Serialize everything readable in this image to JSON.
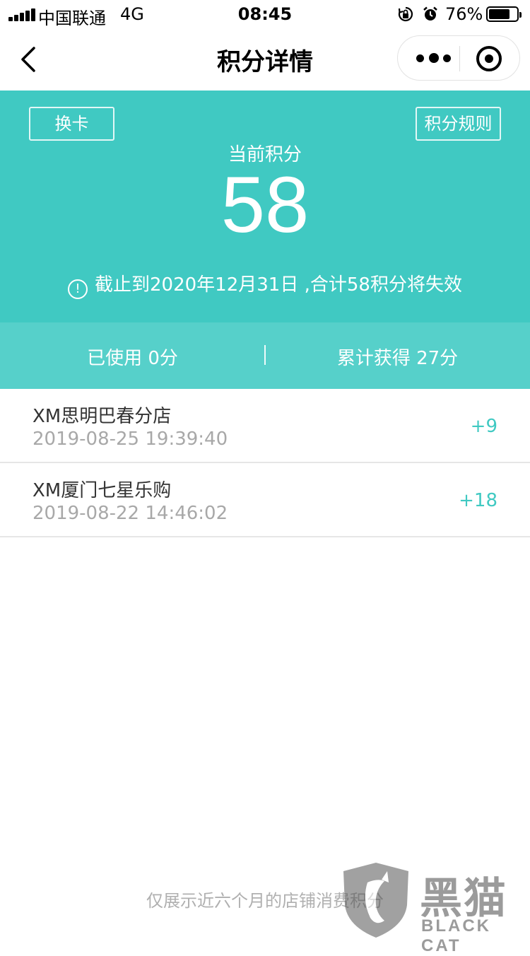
{
  "status_bar": {
    "carrier": "中国联通",
    "network": "4G",
    "time": "08:45",
    "battery_percent_label": "76%",
    "battery_level": 0.76,
    "rotation_icon": "rotation-lock-icon",
    "alarm_icon": "alarm-icon"
  },
  "nav": {
    "title": "积分详情",
    "back_icon": "chevron-left-icon",
    "more_icon": "more-dots-icon",
    "close_icon": "mini-program-close-icon"
  },
  "header": {
    "swap_card_label": "换卡",
    "rules_label": "积分规则",
    "current_points_label": "当前积分",
    "current_points_value": "58",
    "expiry_notice": "截止到2020年12月31日 ,合计58积分将失效",
    "info_icon_glyph": "!"
  },
  "stats": {
    "used": "已使用 0分",
    "earned": "累计获得 27分"
  },
  "records": [
    {
      "store": "XM思明巴春分店",
      "time": "2019-08-25 19:39:40",
      "points": "+9"
    },
    {
      "store": "XM厦门七星乐购",
      "time": "2019-08-22 14:46:02",
      "points": "+18"
    }
  ],
  "footer": {
    "note": "仅展示近六个月的店铺消费积分"
  },
  "watermark": {
    "cn": "黑猫",
    "en": "BLACK CAT"
  },
  "colors": {
    "accent": "#40c9c2",
    "stats_bg": "#56d0ca",
    "muted_text": "#a8a8a8"
  }
}
